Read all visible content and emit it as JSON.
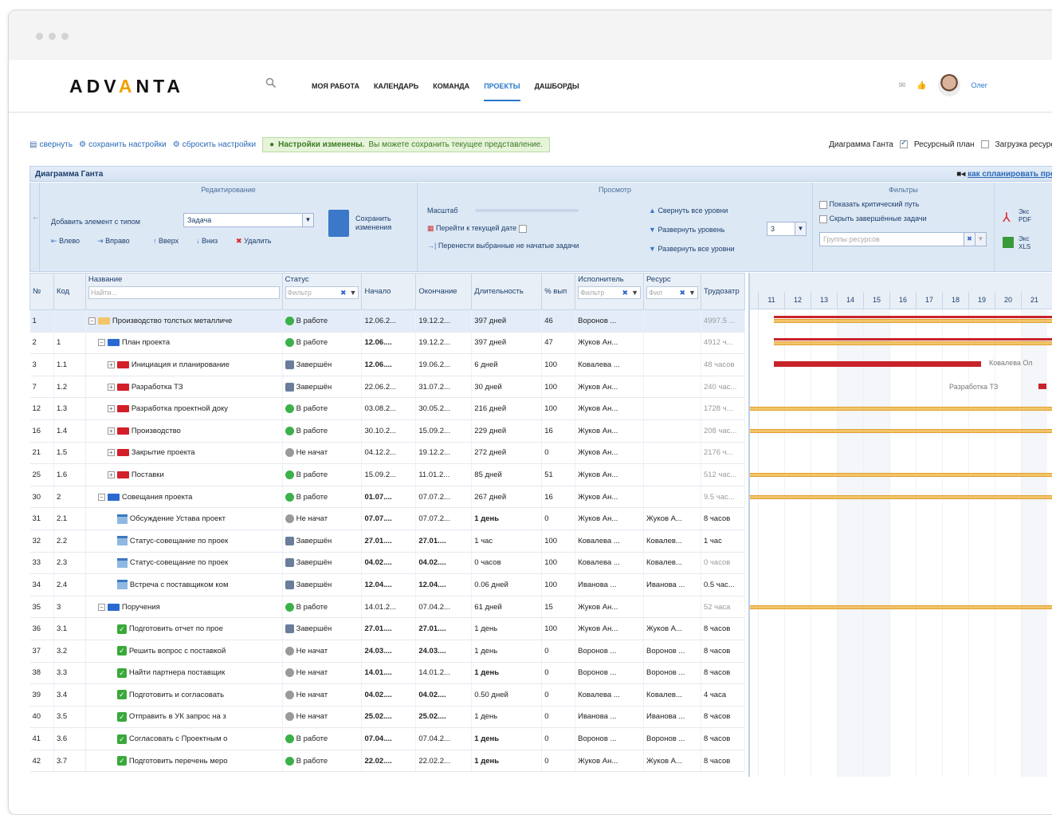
{
  "app": {
    "logo_pre": "ADV",
    "logo_acc": "A",
    "logo_post": "NTA",
    "nav": [
      "МОЯ РАБОТА",
      "КАЛЕНДАРЬ",
      "КОМАНДА",
      "ПРОЕКТЫ",
      "ДАШБОРДЫ"
    ],
    "active_nav": "ПРОЕКТЫ",
    "user_name": "Олег"
  },
  "toolbar": {
    "collapse": "свернуть",
    "save_settings": "сохранить настройки",
    "reset_settings": "сбросить настройки",
    "msg_bold": "Настройки изменены.",
    "msg_text": " Вы можете сохранить текущее представление.",
    "view_gantt": "Диаграмма Ганта",
    "view_resource": "Ресурсный план",
    "view_load": "Загрузка ресурсо"
  },
  "gantt_title": "Диаграмма Ганта",
  "how_to": "как спланировать про",
  "ribbon": {
    "edit_title": "Редактирование",
    "add_element": "Добавить элемент с типом",
    "type_value": "Задача",
    "save_changes_1": "Сохранить",
    "save_changes_2": "изменения",
    "left": "Влево",
    "right": "Вправо",
    "up": "Вверх",
    "down": "Вниз",
    "delete": "Удалить",
    "view_title": "Просмотр",
    "scale": "Масштаб",
    "goto_date": "Перейти к текущей дате",
    "move_selected": "Перенести выбранные не начатые задачи",
    "collapse_all": "Свернуть все уровни",
    "expand_level": "Развернуть уровень",
    "level_value": "3",
    "expand_all": "Развернуть все уровни",
    "filters_title": "Фильтры",
    "show_critical": "Показать критический путь",
    "hide_done": "Скрыть завершённые задачи",
    "resource_groups_placeholder": "Группы ресурсов",
    "export_pdf_1": "Экс",
    "export_pdf_2": "PDF",
    "export_xls_1": "Экс",
    "export_xls_2": "XLS"
  },
  "columns": {
    "num": "№",
    "code": "Код",
    "name": "Название",
    "name_filter": "Найти...",
    "status": "Статус",
    "status_filter": "Фильтр",
    "start": "Начало",
    "end": "Окончание",
    "duration": "Длительность",
    "pct": "% вып",
    "executor": "Исполнитель",
    "executor_filter": "Фильтр",
    "resource": "Ресурс",
    "resource_filter": "Фил",
    "effort": "Трудозатр"
  },
  "days": [
    "11",
    "12",
    "13",
    "14",
    "15",
    "16",
    "17",
    "18",
    "19",
    "20",
    "21"
  ],
  "rows": [
    {
      "num": "1",
      "code": "",
      "name": "Производство толстых металличе",
      "icon": "folder",
      "indent": 0,
      "toggle": "−",
      "status": "В работе",
      "st": "work",
      "start": "12.06.2...",
      "start_bold": false,
      "end": "19.12.2...",
      "end_bold": false,
      "dur": "397 дней",
      "dur_bold": false,
      "pct": "46",
      "exec": "Воронов ...",
      "res": "",
      "effort": "4997.5 ...",
      "effort_muted": true
    },
    {
      "num": "2",
      "code": "1",
      "name": "План проекта",
      "icon": "blue",
      "indent": 1,
      "toggle": "−",
      "status": "В работе",
      "st": "work",
      "start": "12.06....",
      "start_bold": true,
      "end": "19.12.2...",
      "end_bold": false,
      "dur": "397 дней",
      "dur_bold": false,
      "pct": "47",
      "exec": "Жуков Ан...",
      "res": "",
      "effort": "4912 ч...",
      "effort_muted": true
    },
    {
      "num": "3",
      "code": "1.1",
      "name": "Инициация и планирование",
      "icon": "red",
      "indent": 2,
      "toggle": "+",
      "status": "Завершён",
      "st": "done",
      "start": "12.06....",
      "start_bold": true,
      "end": "19.06.2...",
      "end_bold": false,
      "dur": "6 дней",
      "dur_bold": false,
      "pct": "100",
      "exec": "Ковалева ...",
      "res": "",
      "effort": "48 часов",
      "effort_muted": true
    },
    {
      "num": "7",
      "code": "1.2",
      "name": "Разработка ТЗ",
      "icon": "red",
      "indent": 2,
      "toggle": "+",
      "status": "Завершён",
      "st": "done",
      "start": "22.06.2...",
      "start_bold": false,
      "end": "31.07.2...",
      "end_bold": false,
      "dur": "30 дней",
      "dur_bold": false,
      "pct": "100",
      "exec": "Жуков Ан...",
      "res": "",
      "effort": "240 час...",
      "effort_muted": true
    },
    {
      "num": "12",
      "code": "1.3",
      "name": "Разработка проектной доку",
      "icon": "red",
      "indent": 2,
      "toggle": "+",
      "status": "В работе",
      "st": "work",
      "start": "03.08.2...",
      "start_bold": false,
      "end": "30.05.2...",
      "end_bold": false,
      "dur": "216 дней",
      "dur_bold": false,
      "pct": "100",
      "exec": "Жуков Ан...",
      "res": "",
      "effort": "1728 ч...",
      "effort_muted": true
    },
    {
      "num": "16",
      "code": "1.4",
      "name": "Производство",
      "icon": "red",
      "indent": 2,
      "toggle": "+",
      "status": "В работе",
      "st": "work",
      "start": "30.10.2...",
      "start_bold": false,
      "end": "15.09.2...",
      "end_bold": false,
      "dur": "229 дней",
      "dur_bold": false,
      "pct": "16",
      "exec": "Жуков Ан...",
      "res": "",
      "effort": "208 час...",
      "effort_muted": true
    },
    {
      "num": "21",
      "code": "1.5",
      "name": "Закрытие проекта",
      "icon": "red",
      "indent": 2,
      "toggle": "+",
      "status": "Не начат",
      "st": "not",
      "start": "04.12.2...",
      "start_bold": false,
      "end": "19.12.2...",
      "end_bold": false,
      "dur": "272 дней",
      "dur_bold": false,
      "pct": "0",
      "exec": "Жуков Ан...",
      "res": "",
      "effort": "2176 ч...",
      "effort_muted": true
    },
    {
      "num": "25",
      "code": "1.6",
      "name": "Поставки",
      "icon": "red",
      "indent": 2,
      "toggle": "+",
      "status": "В работе",
      "st": "work",
      "start": "15.09.2...",
      "start_bold": false,
      "end": "11.01.2...",
      "end_bold": false,
      "dur": "85 дней",
      "dur_bold": false,
      "pct": "51",
      "exec": "Жуков Ан...",
      "res": "",
      "effort": "512 час...",
      "effort_muted": true
    },
    {
      "num": "30",
      "code": "2",
      "name": "Совещания проекта",
      "icon": "blue",
      "indent": 1,
      "toggle": "−",
      "status": "В работе",
      "st": "work",
      "start": "01.07....",
      "start_bold": true,
      "end": "07.07.2...",
      "end_bold": false,
      "dur": "267 дней",
      "dur_bold": false,
      "pct": "16",
      "exec": "Жуков Ан...",
      "res": "",
      "effort": "9.5 час...",
      "effort_muted": true
    },
    {
      "num": "31",
      "code": "2.1",
      "name": "Обсуждение Устава проект",
      "icon": "meeting",
      "indent": 3,
      "toggle": "",
      "status": "Не начат",
      "st": "not",
      "start": "07.07....",
      "start_bold": true,
      "end": "07.07.2...",
      "end_bold": false,
      "dur": "1 день",
      "dur_bold": true,
      "pct": "0",
      "exec": "Жуков Ан...",
      "res": "Жуков А...",
      "effort": "8 часов",
      "effort_muted": false
    },
    {
      "num": "32",
      "code": "2.2",
      "name": "Статус-совещание по проек",
      "icon": "meeting",
      "indent": 3,
      "toggle": "",
      "status": "Завершён",
      "st": "done",
      "start": "27.01....",
      "start_bold": true,
      "end": "27.01....",
      "end_bold": true,
      "dur": "1 час",
      "dur_bold": false,
      "pct": "100",
      "exec": "Ковалева ...",
      "res": "Ковалев...",
      "effort": "1 час",
      "effort_muted": false
    },
    {
      "num": "33",
      "code": "2.3",
      "name": "Статус-совещание по проек",
      "icon": "meeting",
      "indent": 3,
      "toggle": "",
      "status": "Завершён",
      "st": "done",
      "start": "04.02....",
      "start_bold": true,
      "end": "04.02....",
      "end_bold": true,
      "dur": "0 часов",
      "dur_bold": false,
      "pct": "100",
      "exec": "Ковалева ...",
      "res": "Ковалев...",
      "effort": "0 часов",
      "effort_muted": true
    },
    {
      "num": "34",
      "code": "2.4",
      "name": "Встреча с поставщиком ком",
      "icon": "meeting",
      "indent": 3,
      "toggle": "",
      "status": "Завершён",
      "st": "done",
      "start": "12.04....",
      "start_bold": true,
      "end": "12.04....",
      "end_bold": true,
      "dur": "0.06 дней",
      "dur_bold": false,
      "pct": "100",
      "exec": "Иванова ...",
      "res": "Иванова ...",
      "effort": "0.5 час...",
      "effort_muted": false
    },
    {
      "num": "35",
      "code": "3",
      "name": "Поручения",
      "icon": "blue",
      "indent": 1,
      "toggle": "−",
      "status": "В работе",
      "st": "work",
      "start": "14.01.2...",
      "start_bold": false,
      "end": "07.04.2...",
      "end_bold": false,
      "dur": "61 дней",
      "dur_bold": false,
      "pct": "15",
      "exec": "Жуков Ан...",
      "res": "",
      "effort": "52 часа",
      "effort_muted": true
    },
    {
      "num": "36",
      "code": "3.1",
      "name": "Подготовить отчет по прое",
      "icon": "task",
      "indent": 3,
      "toggle": "",
      "status": "Завершён",
      "st": "done",
      "start": "27.01....",
      "start_bold": true,
      "end": "27.01....",
      "end_bold": true,
      "dur": "1 день",
      "dur_bold": false,
      "pct": "100",
      "exec": "Жуков Ан...",
      "res": "Жуков А...",
      "effort": "8 часов",
      "effort_muted": false
    },
    {
      "num": "37",
      "code": "3.2",
      "name": "Решить вопрос с поставкой",
      "icon": "task",
      "indent": 3,
      "toggle": "",
      "status": "Не начат",
      "st": "not",
      "start": "24.03....",
      "start_bold": true,
      "end": "24.03....",
      "end_bold": true,
      "dur": "1 день",
      "dur_bold": false,
      "pct": "0",
      "exec": "Воронов ...",
      "res": "Воронов ...",
      "effort": "8 часов",
      "effort_muted": false
    },
    {
      "num": "38",
      "code": "3.3",
      "name": "Найти партнера поставщик",
      "icon": "task",
      "indent": 3,
      "toggle": "",
      "status": "Не начат",
      "st": "not",
      "start": "14.01....",
      "start_bold": true,
      "end": "14.01.2...",
      "end_bold": false,
      "dur": "1 день",
      "dur_bold": true,
      "pct": "0",
      "exec": "Воронов ...",
      "res": "Воронов ...",
      "effort": "8 часов",
      "effort_muted": false
    },
    {
      "num": "39",
      "code": "3.4",
      "name": "Подготовить и согласовать",
      "icon": "task",
      "indent": 3,
      "toggle": "",
      "status": "Не начат",
      "st": "not",
      "start": "04.02....",
      "start_bold": true,
      "end": "04.02....",
      "end_bold": true,
      "dur": "0.50 дней",
      "dur_bold": false,
      "pct": "0",
      "exec": "Ковалева ...",
      "res": "Ковалев...",
      "effort": "4 часа",
      "effort_muted": false
    },
    {
      "num": "40",
      "code": "3.5",
      "name": "Отправить в УК запрос на з",
      "icon": "task",
      "indent": 3,
      "toggle": "",
      "status": "Не начат",
      "st": "not",
      "start": "25.02....",
      "start_bold": true,
      "end": "25.02....",
      "end_bold": true,
      "dur": "1 день",
      "dur_bold": false,
      "pct": "0",
      "exec": "Иванова ...",
      "res": "Иванова ...",
      "effort": "8 часов",
      "effort_muted": false
    },
    {
      "num": "41",
      "code": "3.6",
      "name": "Согласовать с Проектным о",
      "icon": "task",
      "indent": 3,
      "toggle": "",
      "status": "В работе",
      "st": "work",
      "start": "07.04....",
      "start_bold": true,
      "end": "07.04.2...",
      "end_bold": false,
      "dur": "1 день",
      "dur_bold": true,
      "pct": "0",
      "exec": "Воронов ...",
      "res": "Воронов ...",
      "effort": "8 часов",
      "effort_muted": false
    },
    {
      "num": "42",
      "code": "3.7",
      "name": "Подготовить перечень меро",
      "icon": "task",
      "indent": 3,
      "toggle": "",
      "status": "В работе",
      "st": "work",
      "start": "22.02....",
      "start_bold": true,
      "end": "22.02.2...",
      "end_bold": false,
      "dur": "1 день",
      "dur_bold": true,
      "pct": "0",
      "exec": "Жуков Ан...",
      "res": "Жуков А...",
      "effort": "8 часов",
      "effort_muted": false
    }
  ],
  "chart_labels": {
    "kovaleva": "Ковалева Ол",
    "tz": "Разработка ТЗ"
  },
  "colors": {
    "accent": "#2a78c8",
    "summary_bar": "#f2c46a",
    "critical_bar": "#c8232b",
    "status_work": "#3cb04a"
  }
}
